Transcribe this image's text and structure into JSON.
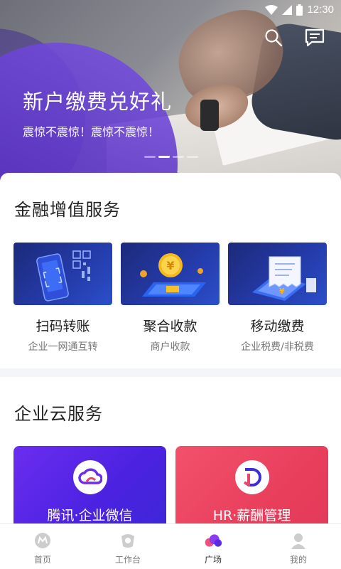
{
  "status_bar": {
    "time": "12:30"
  },
  "banner": {
    "title": "新户缴费兑好礼",
    "subtitle": "震惊不震惊！震惊不震惊！",
    "dots": 4,
    "active_dot": 2
  },
  "finance": {
    "title": "金融增值服务",
    "items": [
      {
        "name": "扫码转账",
        "desc": "企业一网通互转",
        "icon": "qr-phone-illustration"
      },
      {
        "name": "聚合收款",
        "desc": "商户收款",
        "icon": "yuan-coin-illustration"
      },
      {
        "name": "移动缴费",
        "desc": "企业税费/非税费",
        "icon": "receipt-phone-illustration"
      }
    ]
  },
  "cloud": {
    "title": "企业云服务",
    "items": [
      {
        "title": "腾讯·企业微信",
        "icon": "cloud-logo-icon",
        "color": "#5a24e6"
      },
      {
        "title": "HR·薪酬管理",
        "icon": "d-logo-icon",
        "color": "#ec4562"
      }
    ]
  },
  "nav": {
    "items": [
      {
        "label": "首页",
        "icon": "home-icon"
      },
      {
        "label": "工作台",
        "icon": "workbench-icon"
      },
      {
        "label": "广场",
        "icon": "plaza-icon",
        "active": true
      },
      {
        "label": "我的",
        "icon": "profile-icon"
      }
    ]
  },
  "colors": {
    "accent": "#6a2df0",
    "nav_active": "#8a3cf0",
    "nav_inactive": "#c8c8c8"
  }
}
